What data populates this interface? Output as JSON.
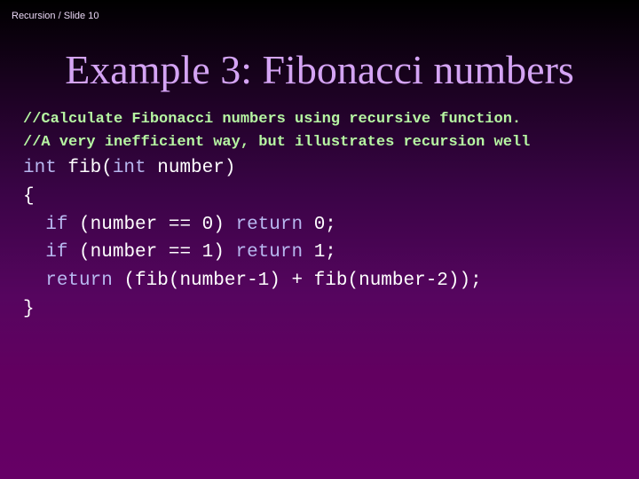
{
  "header": {
    "text": "Recursion / Slide 10"
  },
  "title": "Example 3: Fibonacci numbers",
  "comments": [
    "//Calculate Fibonacci numbers using recursive function.",
    "//A very inefficient way, but illustrates recursion well"
  ],
  "code": {
    "line1": {
      "kw1": "int",
      "t1": " fib(",
      "kw2": "int",
      "t2": " number)"
    },
    "line2": {
      "t1": "{"
    },
    "line3": {
      "indent": "  ",
      "kw1": "if",
      "t1": " (number == 0) ",
      "kw2": "return",
      "t2": " 0;"
    },
    "line4": {
      "indent": "  ",
      "kw1": "if",
      "t1": " (number == 1) ",
      "kw2": "return",
      "t2": " 1;"
    },
    "line5": {
      "indent": "  ",
      "kw1": "return",
      "t1": " (fib(number-1) + fib(number-2));"
    },
    "line6": {
      "t1": "}"
    }
  },
  "colors": {
    "title": "#d4a4f4",
    "comment": "#b6f6a2",
    "keyword": "#b8b8f0",
    "code": "#ffffff",
    "background_bottom": "#660066"
  }
}
